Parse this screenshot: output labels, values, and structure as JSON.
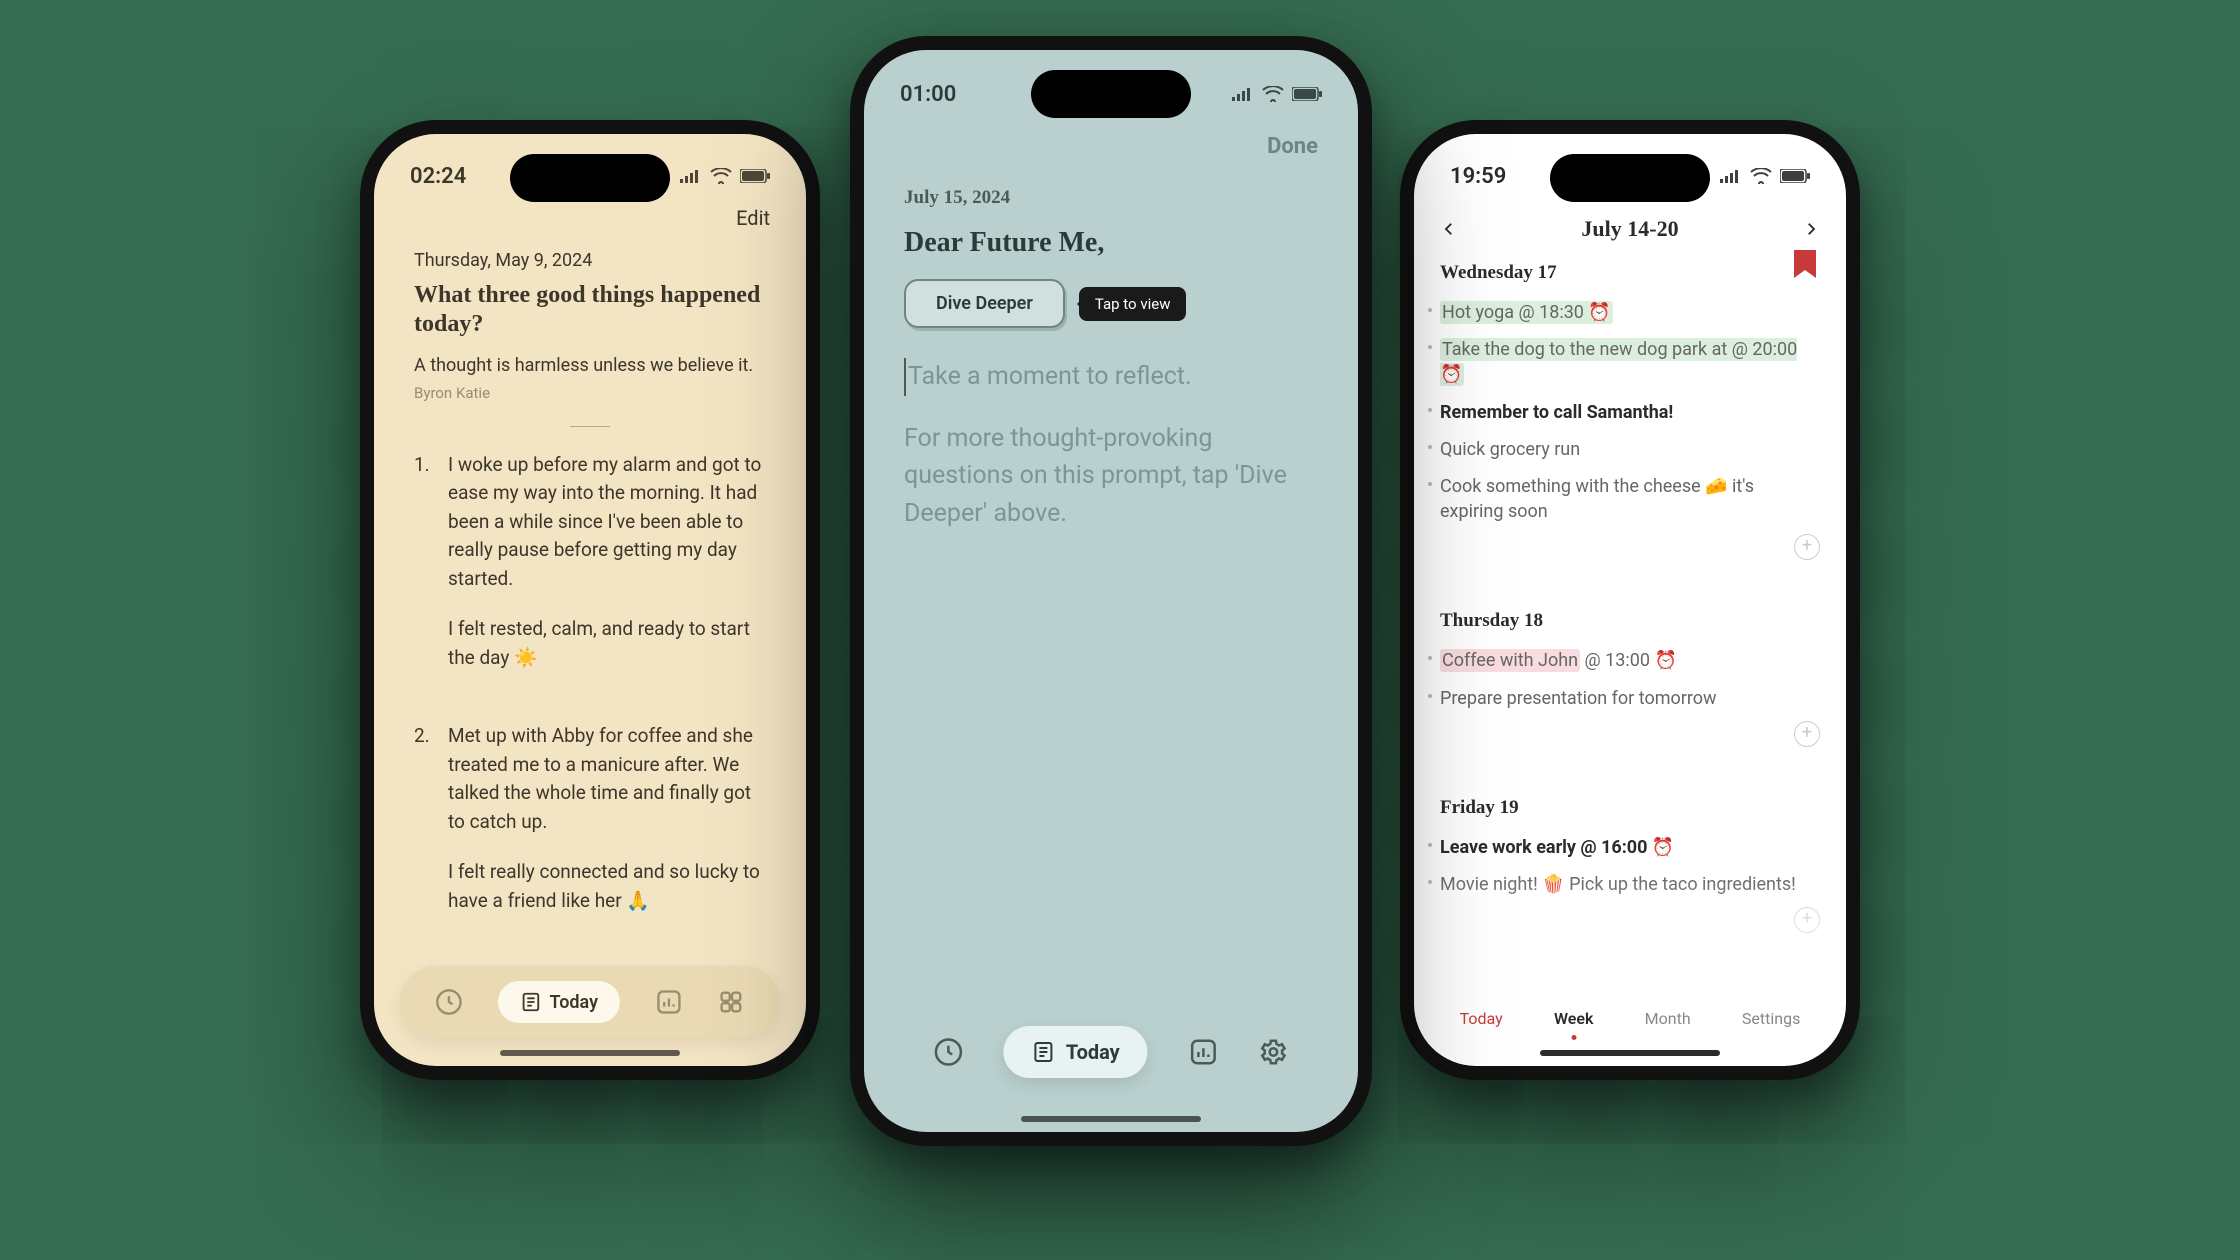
{
  "phoneA": {
    "time": "02:24",
    "edit": "Edit",
    "date": "Thursday, May 9, 2024",
    "prompt": "What three good things happened today?",
    "quote": "A thought is harmless unless we believe it.",
    "author": "Byron Katie",
    "entries": [
      {
        "num": "1.",
        "p1": "I woke up before my alarm and got to ease my way into the morning. It had been a while since I've been able to really pause before getting my day started.",
        "p2": "I felt rested, calm, and ready to start the day ☀️"
      },
      {
        "num": "2.",
        "p1": "Met up with Abby for coffee and she treated me to a manicure after. We talked the whole time and finally got to catch up.",
        "p2": "I felt really connected and so lucky to have a friend like her 🙏"
      }
    ],
    "tab_today": "Today"
  },
  "phoneB": {
    "time": "01:00",
    "done": "Done",
    "date": "July 15, 2024",
    "title": "Dear Future Me,",
    "dive_btn": "Dive Deeper",
    "tooltip": "Tap to view",
    "placeholder_line1": "Take a moment to reflect.",
    "placeholder_line2": "For more thought-provoking questions on this prompt, tap 'Dive Deeper' above.",
    "tab_today": "Today"
  },
  "phoneC": {
    "time": "19:59",
    "header_title": "July 14-20",
    "days": [
      {
        "head": "Wednesday 17",
        "tasks": [
          {
            "text": "Hot yoga @ 18:30 ⏰",
            "hl": "green"
          },
          {
            "text": "Take the dog to the new dog park at @ 20:00 ⏰",
            "hl": "green"
          },
          {
            "text": "Remember to call Samantha!",
            "bold": true
          },
          {
            "text": "Quick grocery run"
          },
          {
            "text": "Cook something with the cheese 🧀 it's expiring soon"
          }
        ]
      },
      {
        "head": "Thursday 18",
        "tasks": [
          {
            "text": "Coffee with John",
            "suffix": " @ 13:00 ⏰",
            "hl": "pink"
          },
          {
            "text": "Prepare presentation for tomorrow"
          }
        ]
      },
      {
        "head": "Friday 19",
        "tasks": [
          {
            "text": "Leave work early @ 16:00 ⏰",
            "bold": true
          },
          {
            "text": "Movie night! 🍿 Pick up the taco ingredients!"
          }
        ]
      }
    ],
    "tabs": {
      "today": "Today",
      "week": "Week",
      "month": "Month",
      "settings": "Settings"
    }
  }
}
